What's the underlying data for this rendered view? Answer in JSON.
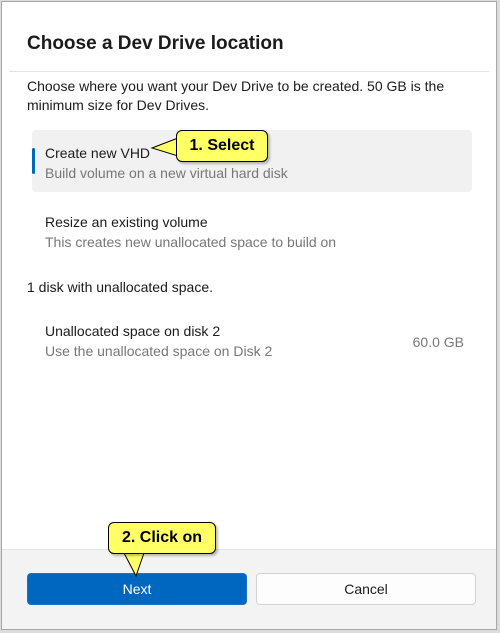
{
  "dialog": {
    "title": "Choose a Dev Drive location",
    "description": "Choose where you want your Dev Drive to be created. 50 GB is the minimum size for Dev Drives."
  },
  "options": [
    {
      "title": "Create new VHD",
      "subtitle": "Build volume on a new virtual hard disk",
      "selected": true
    },
    {
      "title": "Resize an existing volume",
      "subtitle": "This creates new unallocated space to build on",
      "selected": false
    }
  ],
  "unallocated": {
    "section_label": "1 disk with unallocated space.",
    "items": [
      {
        "title": "Unallocated space on disk 2",
        "subtitle": "Use the unallocated space on Disk 2",
        "size": "60.0 GB"
      }
    ]
  },
  "buttons": {
    "next": "Next",
    "cancel": "Cancel"
  },
  "callouts": {
    "select": "1. Select",
    "click_on": "2. Click on"
  },
  "colors": {
    "accent": "#0067c0",
    "callout": "#ffff66"
  }
}
